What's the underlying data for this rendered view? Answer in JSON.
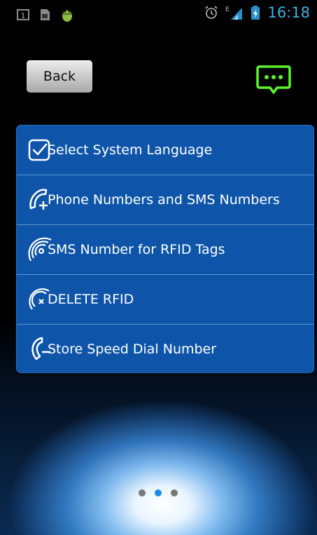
{
  "statusbar": {
    "time": "16:18",
    "left_icons": [
      "screen-number-icon",
      "sd-card-icon",
      "android-debug-icon"
    ],
    "right_icons": [
      "alarm-icon",
      "signal-icon",
      "battery-charging-icon"
    ],
    "network_type": "E",
    "screen_number": "1"
  },
  "header": {
    "back_label": "Back",
    "message_icon": "chat-bubble-icon"
  },
  "menu": {
    "items": [
      {
        "label": "Select System Language",
        "icon": "checkbox-icon"
      },
      {
        "label": "Phone Numbers and SMS Numbers",
        "icon": "phone-add-icon"
      },
      {
        "label": "SMS Number for RFID Tags",
        "icon": "rfid-signal-icon"
      },
      {
        "label": "DELETE RFID",
        "icon": "rfid-delete-icon"
      },
      {
        "label": "Store Speed Dial Number",
        "icon": "phone-speed-dial-icon"
      }
    ]
  },
  "pager": {
    "count": 3,
    "active_index": 1
  },
  "colors": {
    "menu_bg": "#0e55a9",
    "accent_green": "#5cf52b",
    "status_blue": "#3fb1e6",
    "active_dot": "#1a8cf0"
  }
}
